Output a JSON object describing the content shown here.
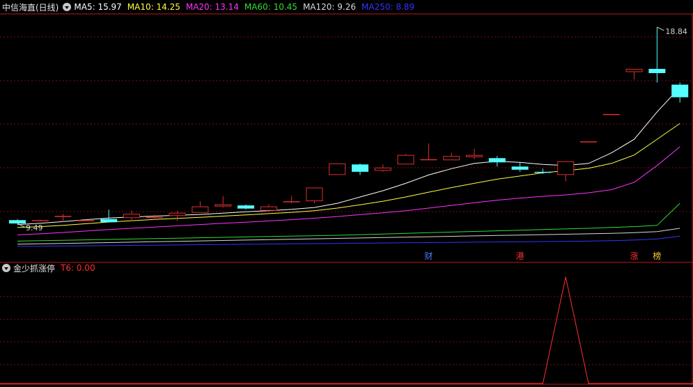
{
  "header": {
    "title": "中信海直(日线)",
    "indicators": [
      {
        "label": "MA5:",
        "value": "15.97",
        "color": "#ffffff"
      },
      {
        "label": "MA10:",
        "value": "14.25",
        "color": "#ffff44"
      },
      {
        "label": "MA20:",
        "value": "13.14",
        "color": "#ff33ff"
      },
      {
        "label": "MA60:",
        "value": "10.45",
        "color": "#33dd33"
      },
      {
        "label": "MA120:",
        "value": "9.26",
        "color": "#d8d8d8"
      },
      {
        "label": "MA250:",
        "value": "8.89",
        "color": "#3333ff"
      }
    ]
  },
  "price_labels": {
    "high": "18.84",
    "low": "9.49"
  },
  "event_markers": [
    {
      "text": "财",
      "color": "#4a7fff"
    },
    {
      "text": "港",
      "color": "#ff3030"
    },
    {
      "text": "涨",
      "color": "#ff3030"
    },
    {
      "text": "榜",
      "color": "#ffcc33"
    }
  ],
  "subpanel": {
    "name": "金少抓涨停",
    "indicator_label": "T6:",
    "indicator_value": "0.00",
    "color": "#ff3030"
  },
  "colors": {
    "up": "#e03030",
    "down": "#55ffff",
    "grid": "#7a1010",
    "frame": "#c01818"
  },
  "chart_data": {
    "type": "candlestick",
    "candles": [
      [
        9.65,
        9.49,
        9.7,
        9.49
      ],
      [
        9.65,
        9.65,
        9.68,
        9.6
      ],
      [
        9.8,
        9.85,
        9.95,
        9.55
      ],
      [
        9.65,
        9.65,
        9.7,
        9.6
      ],
      [
        9.7,
        9.55,
        10.15,
        9.55
      ],
      [
        9.75,
        9.95,
        10.1,
        9.6
      ],
      [
        9.8,
        9.8,
        9.9,
        9.65
      ],
      [
        9.85,
        10.0,
        10.1,
        9.6
      ],
      [
        10.0,
        10.3,
        10.55,
        10.0
      ],
      [
        10.3,
        10.4,
        10.8,
        10.25
      ],
      [
        10.35,
        10.2,
        10.4,
        10.15
      ],
      [
        10.1,
        10.3,
        10.4,
        10.05
      ],
      [
        10.5,
        10.55,
        10.8,
        10.45
      ],
      [
        10.55,
        11.2,
        11.2,
        10.45
      ],
      [
        11.8,
        12.35,
        12.35,
        11.8
      ],
      [
        12.3,
        11.95,
        12.35,
        11.8
      ],
      [
        12.0,
        12.15,
        12.3,
        11.95
      ],
      [
        12.3,
        12.75,
        12.8,
        12.3
      ],
      [
        12.55,
        12.55,
        13.3,
        12.5
      ],
      [
        12.5,
        12.7,
        12.85,
        12.5
      ],
      [
        12.65,
        12.75,
        13.05,
        12.55
      ],
      [
        12.6,
        12.4,
        12.7,
        12.2
      ],
      [
        12.2,
        12.05,
        12.4,
        11.95
      ],
      [
        11.95,
        11.9,
        12.1,
        11.85
      ],
      [
        11.8,
        12.45,
        12.45,
        11.5
      ],
      [
        13.4,
        13.4,
        13.4,
        13.4
      ],
      [
        14.7,
        14.7,
        14.7,
        14.7
      ],
      [
        16.7,
        16.85,
        16.85,
        16.35
      ],
      [
        16.85,
        16.65,
        18.84,
        16.2
      ],
      [
        16.1,
        15.5,
        16.2,
        15.25
      ]
    ],
    "ma_series": [
      {
        "name": "MA5",
        "values": [
          9.44,
          9.5,
          9.58,
          9.67,
          9.75,
          9.8,
          9.84,
          9.88,
          9.92,
          9.98,
          10.05,
          10.1,
          10.16,
          10.25,
          10.45,
          10.75,
          11.05,
          11.4,
          11.8,
          12.1,
          12.35,
          12.45,
          12.4,
          12.3,
          12.25,
          12.35,
          12.85,
          13.5,
          14.8,
          15.97
        ]
      },
      {
        "name": "MA10",
        "values": [
          9.3,
          9.34,
          9.4,
          9.48,
          9.56,
          9.62,
          9.68,
          9.73,
          9.78,
          9.84,
          9.9,
          9.96,
          10.02,
          10.1,
          10.22,
          10.38,
          10.55,
          10.75,
          10.98,
          11.2,
          11.4,
          11.6,
          11.75,
          11.9,
          12.0,
          12.12,
          12.35,
          12.75,
          13.5,
          14.25
        ]
      },
      {
        "name": "MA20",
        "values": [
          8.95,
          9.0,
          9.06,
          9.13,
          9.2,
          9.26,
          9.32,
          9.38,
          9.44,
          9.5,
          9.55,
          9.61,
          9.67,
          9.74,
          9.82,
          9.91,
          10.0,
          10.1,
          10.22,
          10.35,
          10.48,
          10.6,
          10.7,
          10.78,
          10.85,
          10.95,
          11.1,
          11.45,
          12.25,
          13.14
        ]
      },
      {
        "name": "MA60",
        "values": [
          8.65,
          8.67,
          8.69,
          8.71,
          8.73,
          8.75,
          8.77,
          8.79,
          8.81,
          8.83,
          8.85,
          8.87,
          8.89,
          8.91,
          8.93,
          8.96,
          8.99,
          9.02,
          9.05,
          9.08,
          9.11,
          9.14,
          9.17,
          9.2,
          9.23,
          9.26,
          9.3,
          9.34,
          9.4,
          10.45
        ]
      },
      {
        "name": "MA120",
        "values": [
          8.5,
          8.52,
          8.54,
          8.56,
          8.58,
          8.6,
          8.62,
          8.64,
          8.66,
          8.68,
          8.7,
          8.72,
          8.74,
          8.76,
          8.78,
          8.8,
          8.82,
          8.84,
          8.86,
          8.88,
          8.9,
          8.92,
          8.94,
          8.96,
          8.98,
          9.0,
          9.02,
          9.05,
          9.1,
          9.26
        ]
      },
      {
        "name": "MA250",
        "values": [
          8.4,
          8.41,
          8.42,
          8.43,
          8.44,
          8.45,
          8.46,
          8.47,
          8.48,
          8.49,
          8.5,
          8.51,
          8.52,
          8.53,
          8.54,
          8.55,
          8.56,
          8.57,
          8.58,
          8.59,
          8.6,
          8.61,
          8.62,
          8.63,
          8.64,
          8.65,
          8.67,
          8.7,
          8.75,
          8.89
        ]
      }
    ],
    "event_candle_index": [
      18,
      22,
      27,
      28
    ],
    "t6_values": [
      0,
      0,
      0,
      0,
      0,
      0,
      0,
      0,
      0,
      0,
      0,
      0,
      0,
      0,
      0,
      0,
      0,
      0,
      0,
      0,
      0,
      0,
      0,
      0,
      1,
      0,
      0,
      0,
      0,
      0
    ],
    "ylim": [
      8.2,
      19.4
    ],
    "grid": true
  }
}
